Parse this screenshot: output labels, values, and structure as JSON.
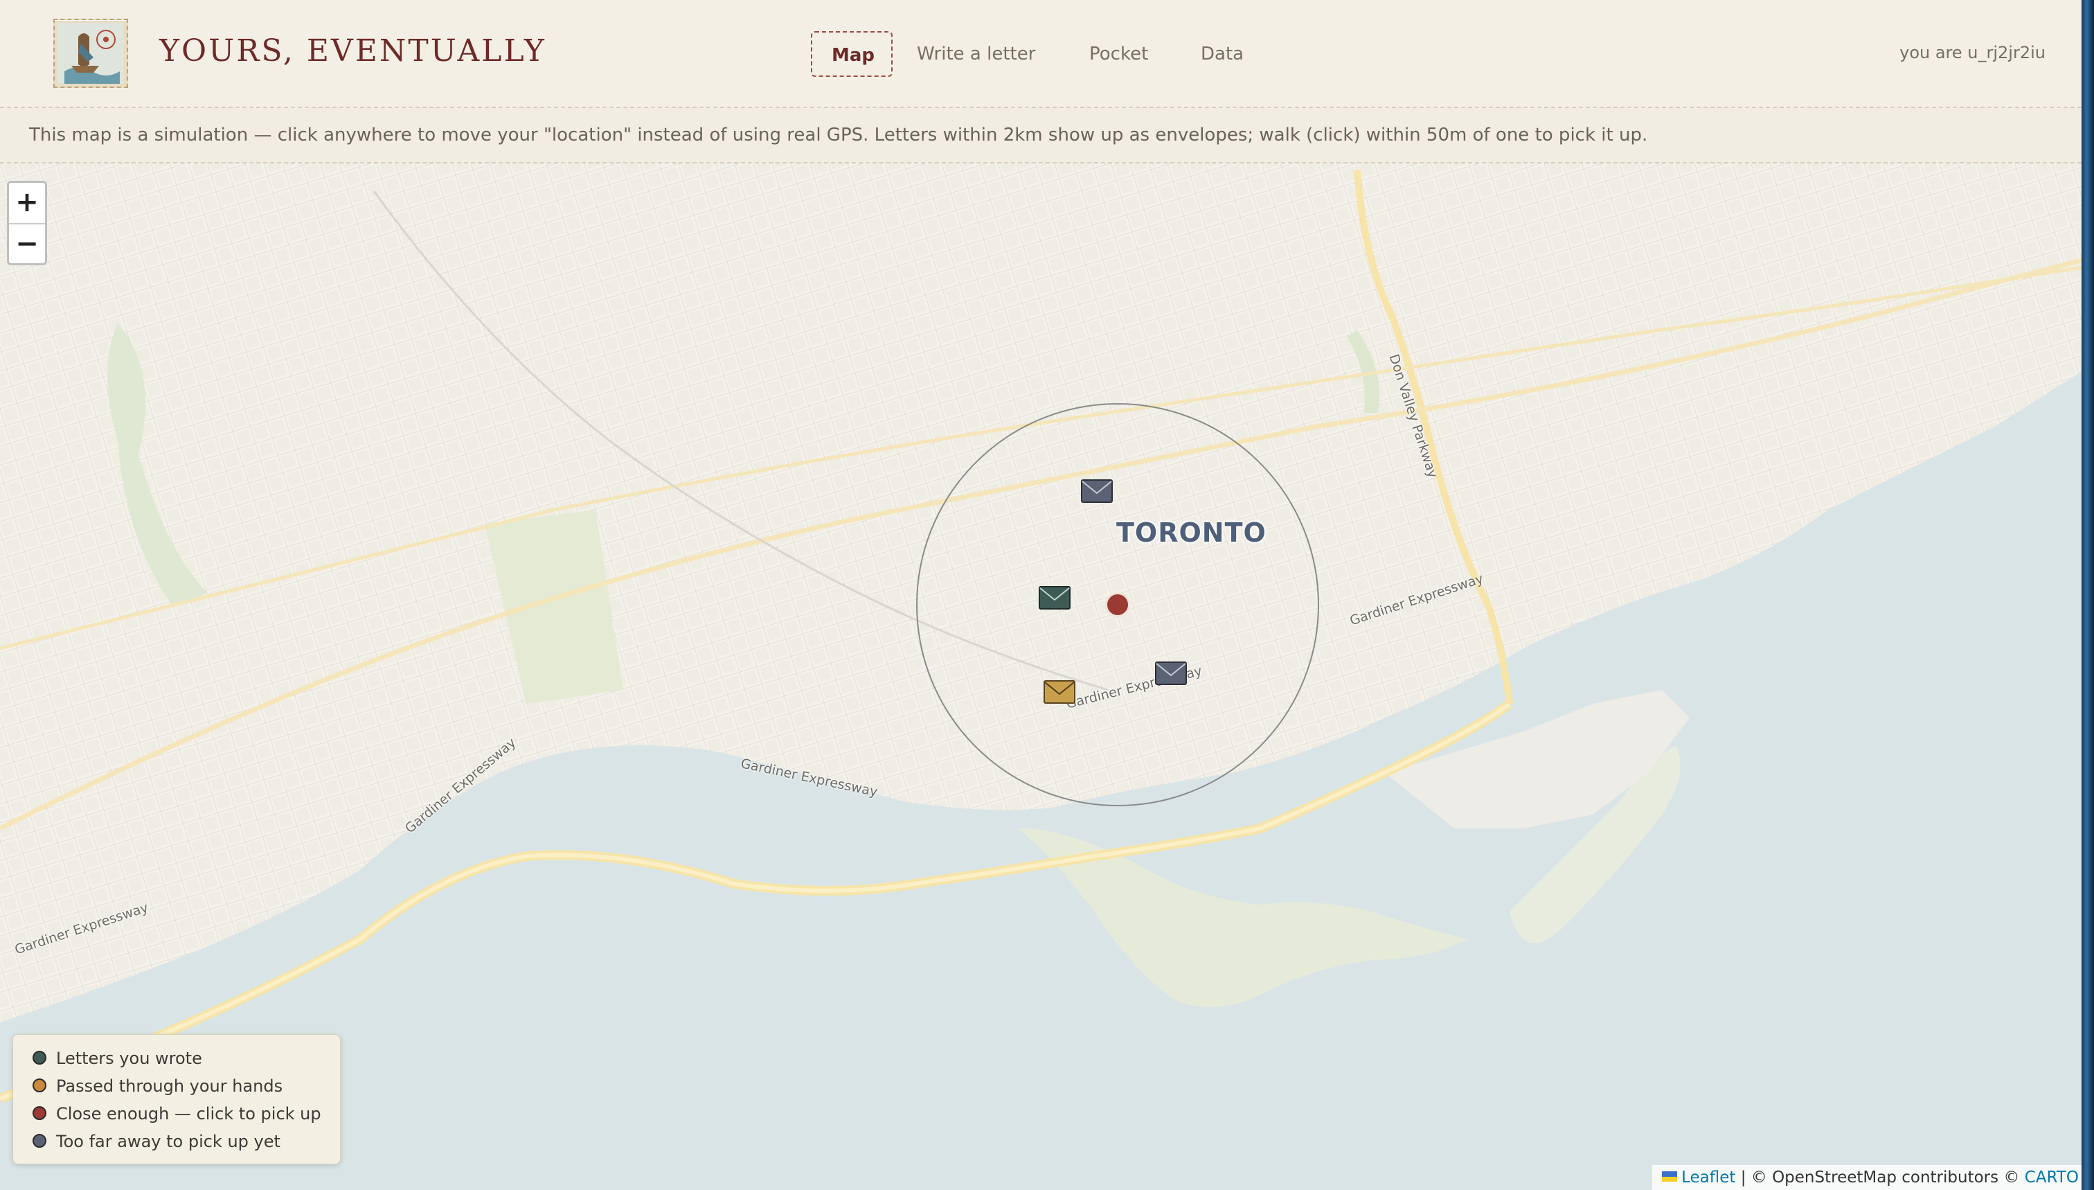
{
  "header": {
    "brand": "YOURS, EVENTUALLY",
    "nav": [
      {
        "label": "Map",
        "active": true
      },
      {
        "label": "Write a letter",
        "active": false
      },
      {
        "label": "Pocket",
        "active": false
      },
      {
        "label": "Data",
        "active": false
      }
    ],
    "user": "you are u_rj2jr2iu"
  },
  "info": "This map is a simulation — click anywhere to move your \"location\" instead of using real GPS. Letters within 2km show up as envelopes; walk (click) within 50m of one to pick it up.",
  "map": {
    "zoom_in": "+",
    "zoom_out": "−",
    "city_label": "TORONTO",
    "road_labels": [
      "Gardiner Expressway",
      "Gardiner Expressway",
      "Gardiner Expressway",
      "Gardiner Expressway",
      "Gardiner Expressway",
      "Don Valley Parkway"
    ],
    "envelopes": [
      {
        "kind": "too-far",
        "color": "#5b6273"
      },
      {
        "kind": "yours",
        "color": "#3e5a55"
      },
      {
        "kind": "passed",
        "color": "#c8a04c"
      },
      {
        "kind": "too-far",
        "color": "#5b6273"
      }
    ],
    "location_color": "#9b3a35"
  },
  "legend": [
    {
      "label": "Letters you wrote",
      "color": "#3e5a55"
    },
    {
      "label": "Passed through your hands",
      "color": "#c9893e"
    },
    {
      "label": "Close enough — click to pick up",
      "color": "#9b3a35"
    },
    {
      "label": "Too far away to pick up yet",
      "color": "#5b6273"
    }
  ],
  "attribution": {
    "leaflet": "Leaflet",
    "separator": "|",
    "osm": "© OpenStreetMap contributors ©",
    "carto": "CARTO"
  },
  "colors": {
    "accent": "#6e2a27",
    "water": "#d9e4e6",
    "land": "#f4f2ec",
    "park": "#e6ecd4",
    "highway": "#f7df9a"
  }
}
